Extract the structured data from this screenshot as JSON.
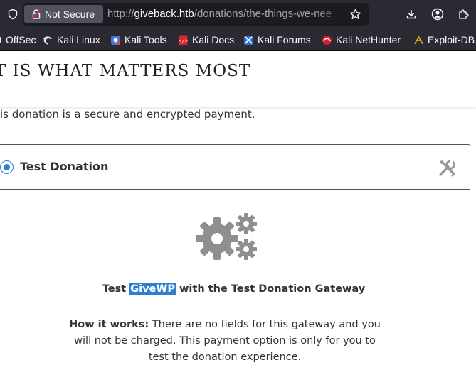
{
  "browser": {
    "security_label": "Not Secure",
    "url_scheme": "http://",
    "url_host": "giveback.htb",
    "url_path": "/donations/the-things-we-nee"
  },
  "bookmarks": [
    {
      "label": "OffSec",
      "icon": "offsec-icon"
    },
    {
      "label": "Kali Linux",
      "icon": "kali-dragon-icon"
    },
    {
      "label": "Kali Tools",
      "icon": "kali-tools-icon"
    },
    {
      "label": "Kali Docs",
      "icon": "kali-docs-icon"
    },
    {
      "label": "Kali Forums",
      "icon": "kali-forums-icon"
    },
    {
      "label": "Kali NetHunter",
      "icon": "nethunter-icon"
    },
    {
      "label": "Exploit-DB",
      "icon": "exploit-db-icon"
    }
  ],
  "page": {
    "title": "T IS WHAT MATTERS MOST",
    "secure_note": "is donation is a secure and encrypted payment."
  },
  "gateway": {
    "label": "Test Donation",
    "selected": true,
    "test_prefix": "Test ",
    "test_highlight": "GiveWP",
    "test_suffix": " with the Test Donation Gateway",
    "how_label": "How it works:",
    "how_text": " There are no fields for this gateway and you will not be charged. This payment option is only for you to test the donation experience."
  },
  "colors": {
    "accent": "#2f7fd1",
    "chrome_bg": "#2b2a33",
    "icon_gray": "#999999"
  }
}
